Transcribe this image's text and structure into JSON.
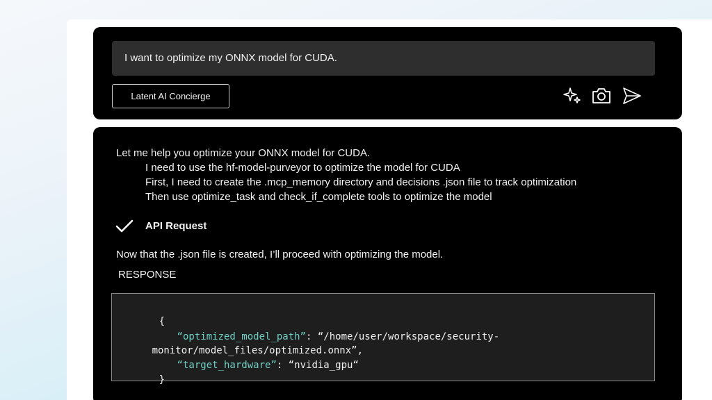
{
  "prompt": {
    "text": "I want to optimize my ONNX model for CUDA."
  },
  "toolbar": {
    "concierge_label": "Latent AI Concierge",
    "icons": [
      "sparkle-icon",
      "camera-icon",
      "send-icon"
    ]
  },
  "response": {
    "intro": "Let me help you optimize your ONNX model for CUDA.",
    "steps": [
      "I need to use the hf-model-purveyor to optimize the model for CUDA",
      "First, I need to create the .mcp_memory directory and decisions .json file to track optimization",
      "Then use optimize_task and check_if_complete tools to optimize the model"
    ],
    "api_request_label": "API Request",
    "followup": "Now that the .json file is created, I’ll proceed with optimizing the model.",
    "response_label": "RESPONSE",
    "code": {
      "open_brace": "{",
      "key1": "“optimized_model_path”",
      "colon1": ": ",
      "value1_part1": "“/home/user/workspace/security-",
      "value1_part2": "monitor/model_files/optimized.onnx”",
      "comma1": ",",
      "key2": "“target_hardware”",
      "colon2": ": ",
      "value2": "“nvidia_gpu“",
      "close_brace": "}"
    }
  },
  "colors": {
    "card_background": "#000000",
    "prompt_background": "#2e2e2e",
    "code_background": "#1e1e1e",
    "code_key": "#6fd0c3"
  }
}
